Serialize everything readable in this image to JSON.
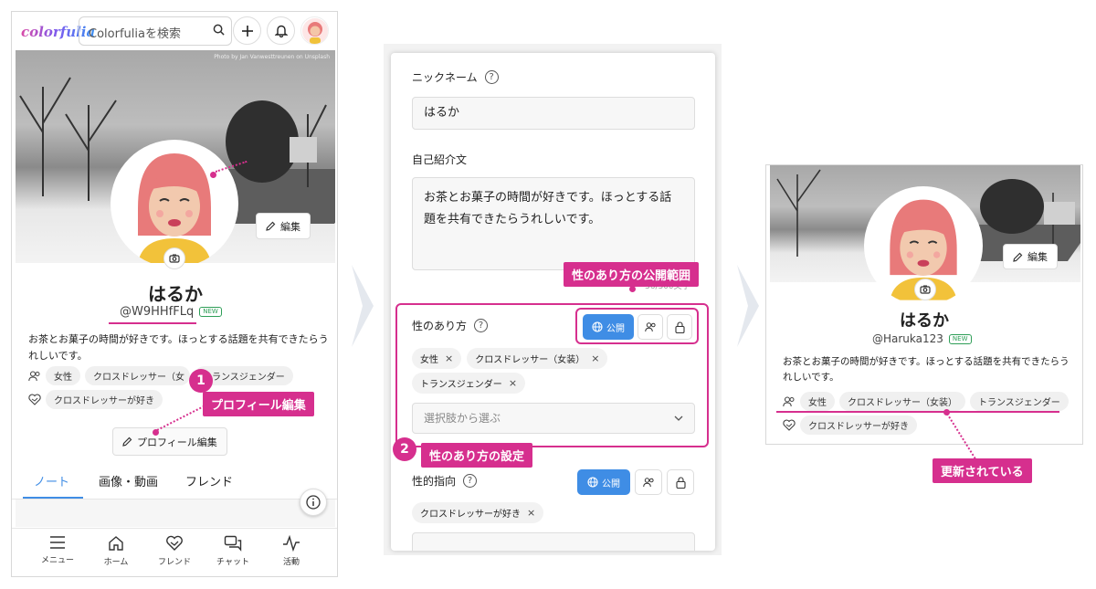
{
  "app": {
    "logo": "colorfulia",
    "search_placeholder": "Colorfuliaを検索"
  },
  "profile": {
    "photo_credit": "Photo by Jan Vanwesttreunen on Unsplash",
    "display_name": "はるか",
    "handle_before": "@W9HHfFLq",
    "handle_after": "@Haruka123",
    "new_badge": "NEW",
    "bio": "お茶とお菓子の時間が好きです。ほっとする話題を共有できたらうれしいです。",
    "edit_cover_label": "編集",
    "edit_profile_label": "プロフィール編集",
    "gender_tags_before": [
      "女性",
      "クロスドレッサー（女",
      "トランスジェンダー"
    ],
    "gender_tags_after": [
      "女性",
      "クロスドレッサー（女装）",
      "トランスジェンダー"
    ],
    "orientation_tags": [
      "クロスドレッサーが好き"
    ]
  },
  "tabs": [
    {
      "label": "ノート",
      "active": true
    },
    {
      "label": "画像・動画",
      "active": false
    },
    {
      "label": "フレンド",
      "active": false
    }
  ],
  "bottom_nav": [
    {
      "label": "メニュー",
      "icon": "menu-icon"
    },
    {
      "label": "ホーム",
      "icon": "home-icon"
    },
    {
      "label": "フレンド",
      "icon": "friends-icon"
    },
    {
      "label": "チャット",
      "icon": "chat-icon"
    },
    {
      "label": "活動",
      "icon": "activity-icon"
    }
  ],
  "form": {
    "nickname_label": "ニックネーム",
    "nickname_value": "はるか",
    "bio_label": "自己紹介文",
    "bio_value": "お茶とお菓子の時間が好きです。ほっとする話題を共有できたらうれしいです。",
    "bio_count": "36/300文字",
    "gender_label": "性のあり方",
    "gender_tags": [
      "女性",
      "クロスドレッサー（女装）",
      "トランスジェンダー"
    ],
    "select_placeholder": "選択肢から選ぶ",
    "orientation_label": "性的指向",
    "orientation_tags": [
      "クロスドレッサーが好き"
    ],
    "public_label": "公開",
    "help_glyph": "?"
  },
  "annotations": {
    "step1_number": "1",
    "step1_label": "プロフィール編集",
    "step2_number": "2",
    "step2_label": "性のあり方の設定",
    "visibility_label": "性のあり方の公開範囲",
    "updated_label": "更新されている"
  },
  "colors": {
    "accent_magenta": "#d62f8e",
    "public_blue": "#3f8de5",
    "tab_blue": "#3f8de5",
    "new_badge_green": "#2e9e57"
  }
}
